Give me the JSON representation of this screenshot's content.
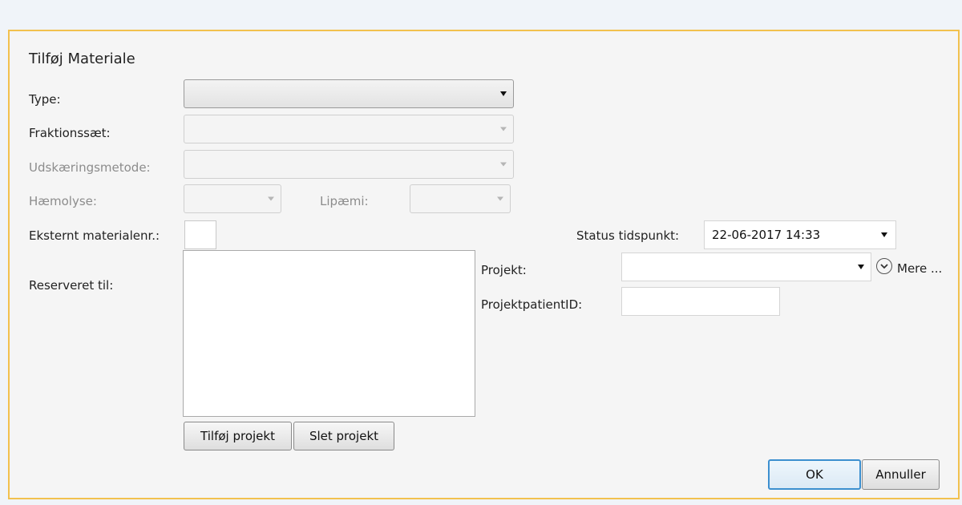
{
  "dialog": {
    "title": "Tilføj Materiale",
    "type_label": "Type:",
    "fraktionssaet_label": "Fraktionssæt:",
    "udskaeringsmetode_label": "Udskæringsmetode:",
    "haemolyse_label": "Hæmolyse:",
    "lipaemi_label": "Lipæmi:",
    "eksternt_label": "Eksternt materialenr.:",
    "status_label": "Status tidspunkt:",
    "status_value": "22-06-2017 14:33",
    "reserveret_label": "Reserveret til:",
    "projekt_label": "Projekt:",
    "projekt_value": "",
    "mere_label": "Mere ...",
    "projektpatient_label": "ProjektpatientID:",
    "projektpatient_value": "",
    "eksternt_value": "",
    "tilfoej_projekt": "Tilføj projekt",
    "slet_projekt": "Slet projekt",
    "ok": "OK",
    "annuller": "Annuller"
  },
  "colors": {
    "dialog_border": "#f2c14e",
    "primary_border": "#3c8fcf"
  },
  "icons": [
    "dropdown-arrow-icon",
    "expand-more-circle-icon"
  ]
}
